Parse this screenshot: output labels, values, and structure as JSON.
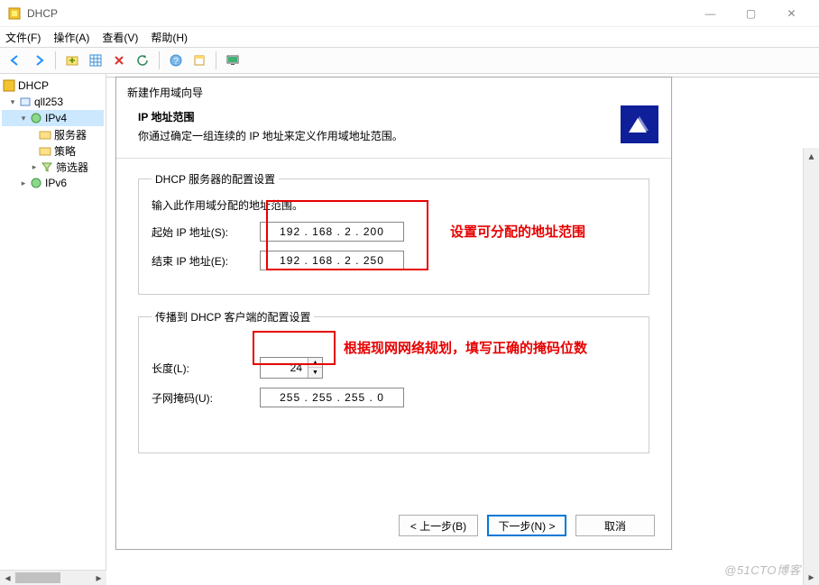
{
  "window": {
    "title": "DHCP",
    "min": "—",
    "max": "▢",
    "close": "✕"
  },
  "menu": {
    "file": "文件(F)",
    "action": "操作(A)",
    "view": "查看(V)",
    "help": "帮助(H)"
  },
  "tree": {
    "root": "DHCP",
    "server": "qll253",
    "ipv4": "IPv4",
    "server_opts": "服务器",
    "policies": "策略",
    "filters": "筛选器",
    "ipv6": "IPv6"
  },
  "dialog": {
    "wizard_title": "新建作用域向导",
    "section_title": "IP 地址范围",
    "section_desc": "你通过确定一组连续的 IP 地址来定义作用域地址范围。",
    "group1_legend": "DHCP 服务器的配置设置",
    "group1_instr": "输入此作用域分配的地址范围。",
    "start_ip_label": "起始 IP 地址(S):",
    "start_ip_value": "192 . 168 .   2  . 200",
    "end_ip_label": "结束 IP 地址(E):",
    "end_ip_value": "192 . 168 .   2  . 250",
    "note1": "设置可分配的地址范围",
    "group2_legend": "传播到 DHCP 客户端的配置设置",
    "length_label": "长度(L):",
    "length_value": "24",
    "mask_label": "子网掩码(U):",
    "mask_value": "255 . 255 . 255 .   0",
    "note2": "根据现网网络规划，填写正确的掩码位数",
    "btn_back": "< 上一步(B)",
    "btn_next": "下一步(N) >",
    "btn_cancel": "取消"
  },
  "watermark": "@51CTO博客"
}
